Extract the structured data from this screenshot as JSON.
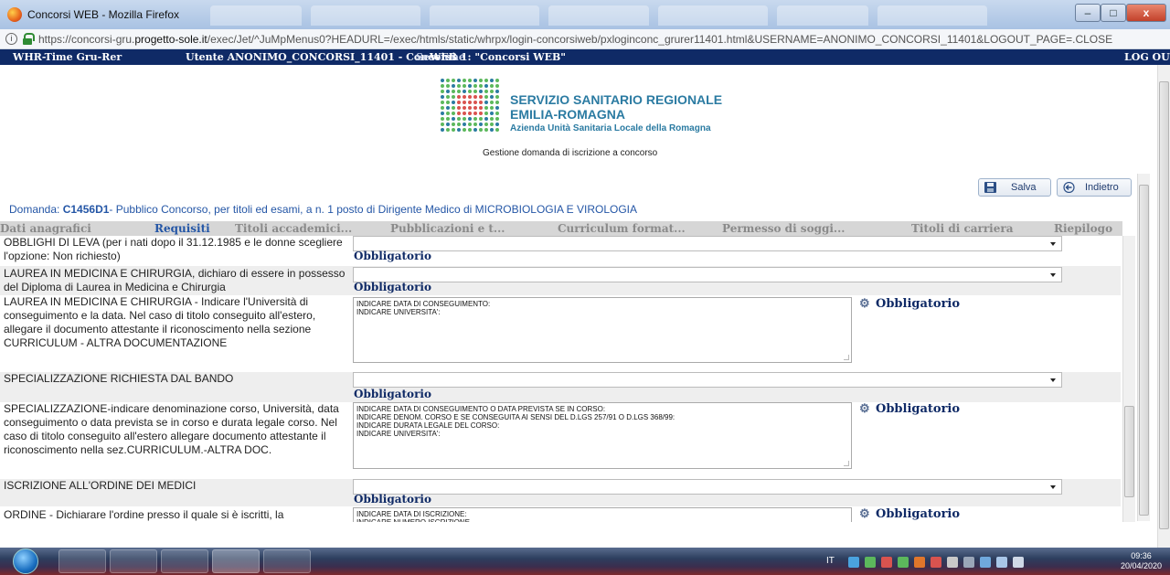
{
  "window": {
    "title": "Concorsi WEB - Mozilla Firefox",
    "min_label": "–",
    "max_label": "□",
    "close_label": "x"
  },
  "browser": {
    "url_prefix": "https://concorsi-gru.",
    "url_domain": "progetto-sole.it",
    "url_rest": "/exec/Jet/^JuMpMenus0?HEADURL=/exec/htmls/static/whrpx/login-concorsiweb/pxloginconc_grurer11401.html&USERNAME=ANONIMO_CONCORSI_11401&LOGOUT_PAGE=.CLOSE"
  },
  "appbar": {
    "app_name": "WHR-Time Gru-Rer",
    "user": "Utente ANONIMO_CONCORSI_11401 - Concorsi",
    "overlap": "Sessione",
    "web": "WEB 1: \"Concorsi WEB\"",
    "logout": "LOG OUT"
  },
  "brand": {
    "line1": "SERVIZIO SANITARIO REGIONALE",
    "line2": "EMILIA-ROMAGNA",
    "line3": "Azienda Unità Sanitaria Locale della Romagna",
    "subtitle": "Gestione domanda di iscrizione a concorso",
    "colors": {
      "primary": "#2b7ba2",
      "accent_red": "#d9534f",
      "accent_green": "#5cb85c"
    }
  },
  "actions": {
    "save": "Salva",
    "back": "Indietro"
  },
  "domanda": {
    "label": "Domanda:",
    "code": "C1456D1",
    "text": "- Pubblico Concorso, per titoli ed esami, a n. 1 posto di Dirigente Medico di MICROBIOLOGIA E VIROLOGIA"
  },
  "tabs": [
    {
      "label": "Dati anagrafici",
      "active": false
    },
    {
      "label": "Requisiti",
      "active": true
    },
    {
      "label": "Titoli accademici...",
      "active": false
    },
    {
      "label": "Pubblicazioni e t...",
      "active": false
    },
    {
      "label": "Curriculum format...",
      "active": false
    },
    {
      "label": "Permesso di soggi...",
      "active": false
    },
    {
      "label": "Titoli di carriera",
      "active": false
    },
    {
      "label": "Riepilogo",
      "active": false
    }
  ],
  "fields": [
    {
      "label": "OBBLIGHI DI LEVA (per i nati dopo il 31.12.1985 e le donne scegliere l'opzione: Non richiesto)",
      "type": "select",
      "value": "",
      "required": "Obbligatorio"
    },
    {
      "label": "LAUREA IN MEDICINA E CHIRURGIA, dichiaro di essere in possesso del Diploma di Laurea in Medicina e Chirurgia",
      "type": "select",
      "value": "",
      "required": "Obbligatorio"
    },
    {
      "label": "LAUREA IN MEDICINA E CHIRURGIA - Indicare l'Università di conseguimento e la data. Nel caso di titolo conseguito all'estero, allegare il documento attestante il riconoscimento nella sezione CURRICULUM - ALTRA DOCUMENTAZIONE",
      "type": "textarea",
      "value": "INDICARE DATA DI CONSEGUIMENTO:\nINDICARE UNIVERSITA':",
      "required": "Obbligatorio"
    },
    {
      "label": "SPECIALIZZAZIONE RICHIESTA DAL BANDO",
      "type": "select",
      "value": "",
      "required": "Obbligatorio"
    },
    {
      "label": "SPECIALIZZAZIONE-indicare denominazione corso, Università, data conseguimento o data prevista se in corso e durata legale corso. Nel caso di titolo conseguito all'estero allegare documento attestante il riconoscimento nella sez.CURRICULUM.-ALTRA DOC.",
      "type": "textarea",
      "value": "INDICARE DATA DI CONSEGUIMENTO O DATA PREVISTA SE IN CORSO:\nINDICARE DENOM. CORSO E SE CONSEGUITA AI SENSI DEL D.LGS 257/91 O D.LGS 368/99:\nINDICARE DURATA LEGALE DEL CORSO:\nINDICARE UNIVERSITA':",
      "required": "Obbligatorio"
    },
    {
      "label": "ISCRIZIONE ALL'ORDINE DEI MEDICI",
      "type": "select",
      "value": "",
      "required": "Obbligatorio"
    },
    {
      "label": "ORDINE - Dichiarare l'ordine presso il quale si è iscritti, la",
      "type": "textarea",
      "value": "INDICARE DATA DI ISCRIZIONE:\nINDICARE NUMERO ISCRIZIONE",
      "required": "Obbligatorio"
    }
  ],
  "taskbar": {
    "lang": "IT",
    "time": "09:36",
    "date": "20/04/2020"
  }
}
